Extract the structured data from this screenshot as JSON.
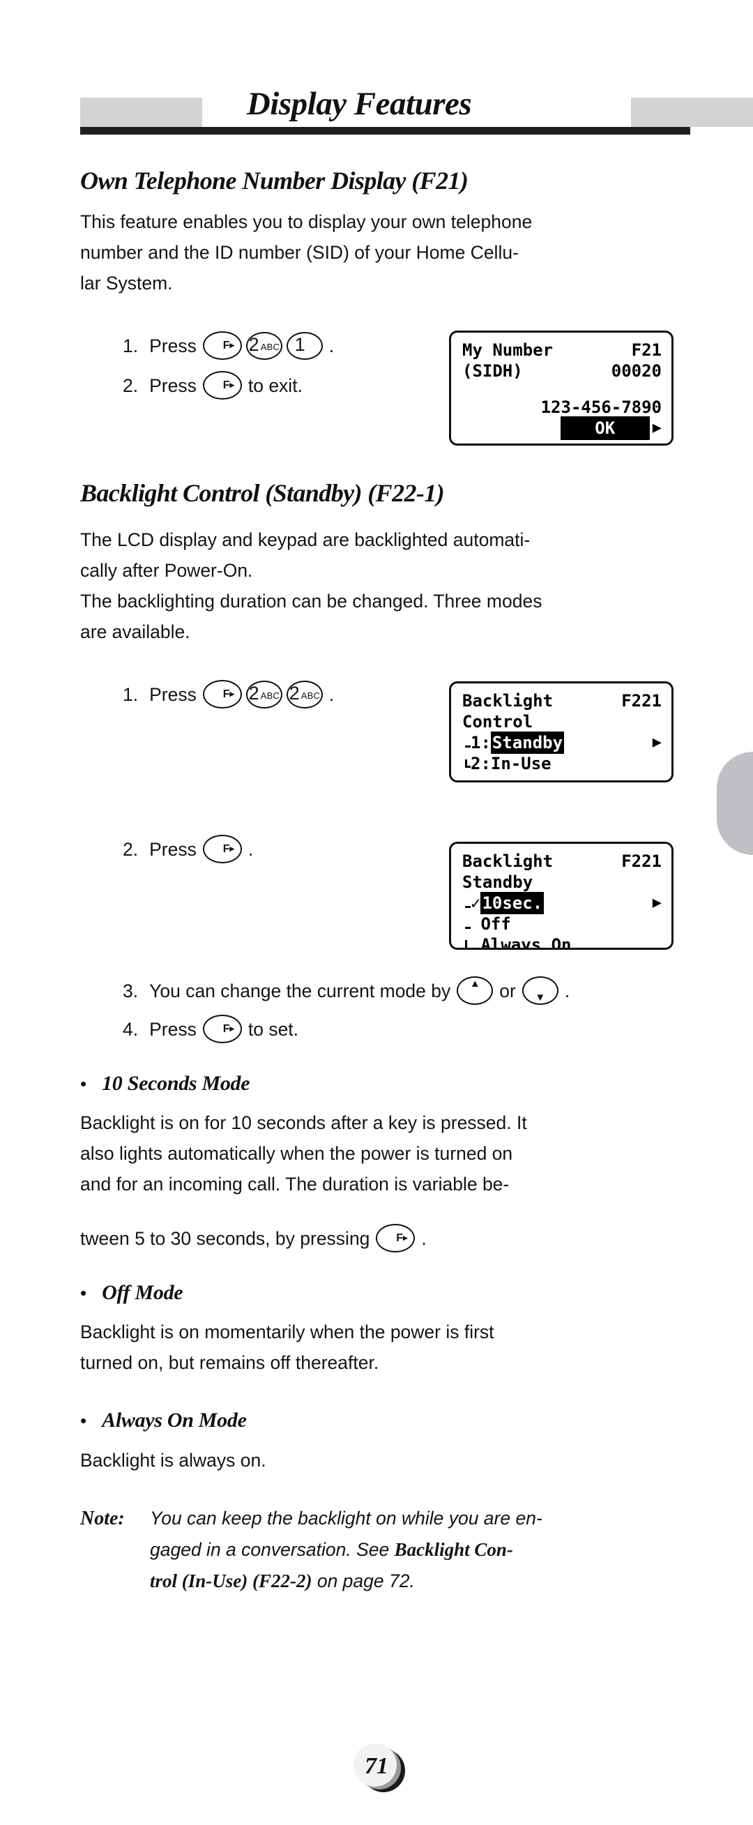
{
  "header": {
    "title": "Display Features"
  },
  "sections": {
    "own_number": {
      "heading": "Own Telephone Number Display (F21)",
      "paragraph_lines": [
        "This feature enables you to display your own telephone",
        "number and the ID number (SID) of your  Home  Cellu-",
        "lar System."
      ],
      "step1": {
        "num": "1.",
        "press": "Press",
        "tail": "."
      },
      "step2": {
        "num": "2.",
        "press": "Press",
        "tail": "to exit."
      }
    },
    "backlight": {
      "heading": "Backlight Control (Standby) (F22-1)",
      "paragraph_lines": [
        "The LCD display and keypad are backlighted automati-",
        "cally after Power-On.",
        "The backlighting duration can be changed. Three modes",
        "are available."
      ],
      "step1": {
        "num": "1.",
        "press": "Press",
        "tail": "."
      },
      "step2": {
        "num": "2.",
        "press": "Press",
        "tail": "."
      },
      "step3": {
        "num": "3.",
        "text_before": "You can change the current mode by",
        "text_middle": "or",
        "tail": "."
      },
      "step4": {
        "num": "4.",
        "press": "Press",
        "tail": "to set."
      }
    },
    "ten_seconds": {
      "bullet": "•",
      "heading": "10 Seconds Mode",
      "lines": [
        "Backlight is on for 10 seconds after a key is pressed. It",
        "also lights automatically when the power is turned on",
        "and for an incoming call. The duration is variable be-",
        "tween 5 to 30 seconds, by pressing"
      ],
      "tail": "."
    },
    "off_mode": {
      "bullet": "•",
      "heading": "Off Mode",
      "lines": [
        "Backlight is on momentarily when the power is first",
        "turned on, but remains off thereafter."
      ]
    },
    "always_on": {
      "bullet": "•",
      "heading": "Always On Mode",
      "lines": [
        "Backlight is always on."
      ]
    }
  },
  "note": {
    "label": "Note:",
    "line1": "You can keep the backlight on while you are en-",
    "line2_a": "gaged in a conversation. See ",
    "line2_ref": "Backlight Con-",
    "line3_ref": "trol (In-Use) (F22-2)",
    "line3_b": "  on page 72."
  },
  "keys": {
    "f_letter": "F",
    "f_triangle": "▸",
    "two_digit": "2",
    "two_letters": "ABC",
    "one_digit": "1",
    "up_triangle": "▲",
    "down_triangle": "▼"
  },
  "lcd1": {
    "title": "My Number",
    "code": "F21",
    "sidh_label": "(SIDH)",
    "sidh_value": "00020",
    "phone_number": "123-456-7890",
    "ok_label": "OK",
    "arrow": "▶"
  },
  "lcd2": {
    "title": "Backlight",
    "code": "F221",
    "subtitle": "Control",
    "item1": "1:",
    "item1_value": "Standby",
    "item2": "2:In-Use",
    "arrow": "▶"
  },
  "lcd3": {
    "title": "Backlight",
    "code": "F221",
    "subtitle": "Standby",
    "check": "✓",
    "item1": "10sec.",
    "item2": "Off",
    "item3": "Always On",
    "arrow": "▶"
  },
  "page_number": "71",
  "colors": {
    "banner_gray": "#d2d3d5",
    "rule_black": "#231f20",
    "tab_gray": "#bfc0c3",
    "ink": "#111111"
  }
}
